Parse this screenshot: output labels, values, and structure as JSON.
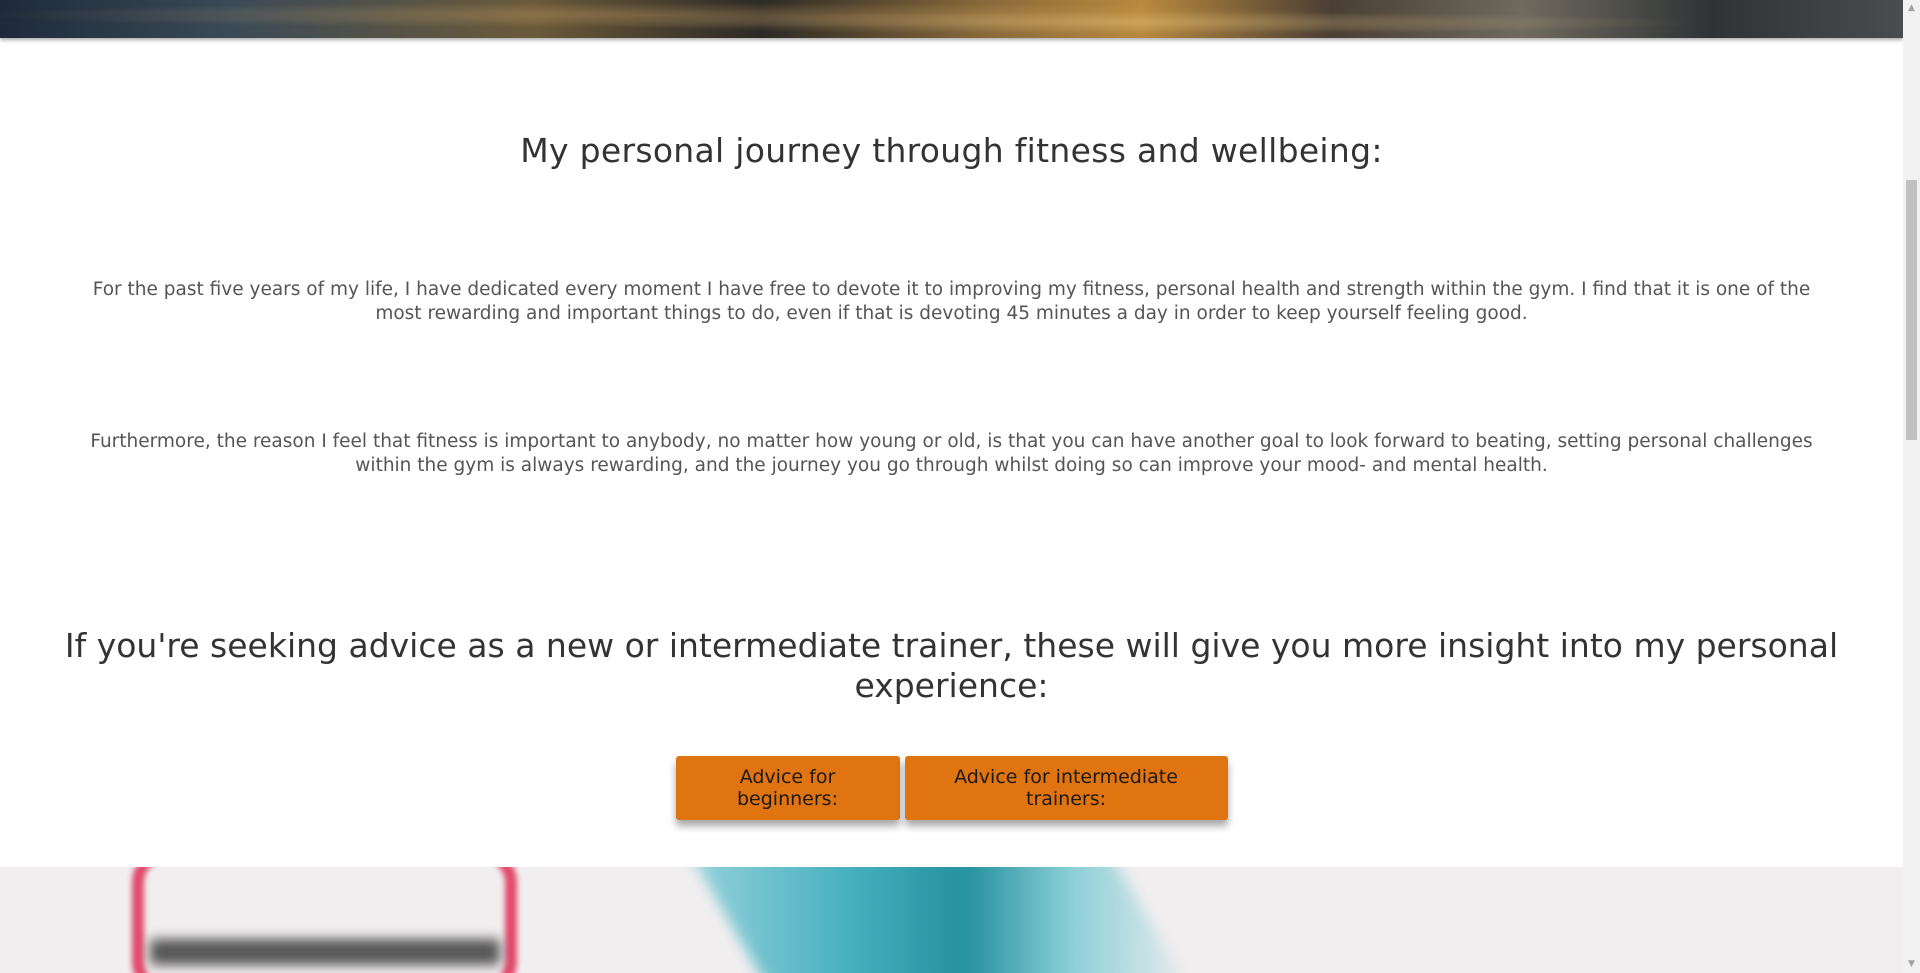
{
  "journey": {
    "title": "My personal journey through fitness and wellbeing:",
    "paragraph_1": "For the past five years of my life, I have dedicated every moment I have free to devote it to improving my fitness, personal health and strength within the gym. I find that it is one of the most rewarding and important things to do, even if that is devoting 45 minutes a day in order to keep yourself feeling good.",
    "paragraph_2": "Furthermore, the reason I feel that fitness is important to anybody, no matter how young or old, is that you can have another goal to look forward to beating, setting personal challenges within the gym is always rewarding, and the journey you go through whilst doing so can improve your mood- and mental health."
  },
  "advice": {
    "title": "If you're seeking advice as a new or intermediate trainer, these will give you more insight into my personal experience:",
    "buttons": {
      "beginners": "Advice for beginners:",
      "intermediate": "Advice for intermediate trainers:"
    }
  },
  "colors": {
    "button_bg": "#e07410",
    "heading_text": "#333333",
    "body_text": "#555555"
  },
  "icons": {
    "scroll_up": "triangle-up-icon",
    "scroll_down": "triangle-down-icon"
  }
}
